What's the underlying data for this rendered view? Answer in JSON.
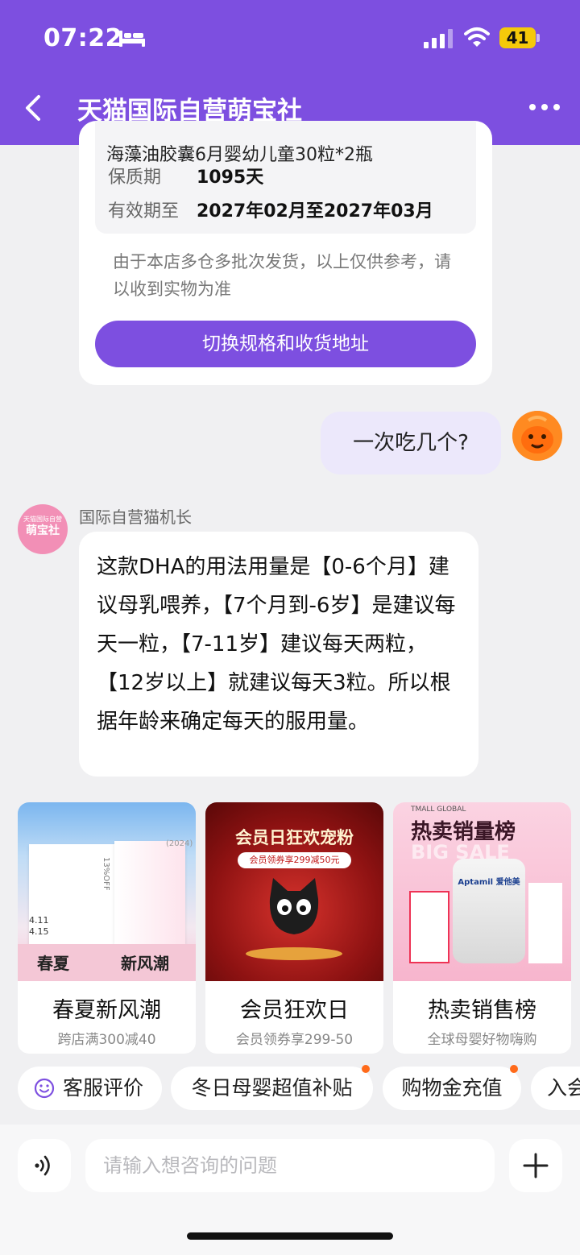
{
  "status_bar": {
    "time": "07:22",
    "battery": "41"
  },
  "nav": {
    "title": "天猫国际自营萌宝社"
  },
  "product_card": {
    "cut_line": "海藻油胶囊6月婴幼儿童30粒*2瓶",
    "rows": [
      {
        "label": "保质期",
        "value": "1095天"
      },
      {
        "label": "有效期至",
        "value": "2027年02月至2027年03月"
      }
    ],
    "note": "由于本店多仓多批次发货，以上仅供参考，请以收到实物为准",
    "switch_button": "切换规格和收货地址"
  },
  "user_message": {
    "text": "一次吃几个?"
  },
  "bot": {
    "avatar_line1": "天猫国际自营",
    "avatar_line2": "萌宝社",
    "name": "国际自营猫机长",
    "message": "这款DHA的用法用量是【0-6个月】建议母乳喂养，【7个月到-6岁】是建议每天一粒，【7-11岁】建议每天两粒，【12岁以上】就建议每天3粒。所以根据年龄来确定每天的服用量。"
  },
  "promos": [
    {
      "title": "春夏新风潮",
      "subtitle": "跨店满300减40",
      "image_caption": "春夏",
      "image_caption2": "新风潮",
      "image_tag": "(2024)",
      "image_date1": "4.11",
      "image_date2": "4.15",
      "image_off": "13%OFF"
    },
    {
      "title": "会员狂欢日",
      "subtitle": "会员领券享299-50",
      "image_caption": "会员日狂欢宠粉",
      "image_caption2": "会员领券享299减50元"
    },
    {
      "title": "热卖销售榜",
      "subtitle": "全球母婴好物嗨购",
      "image_caption": "热卖销量榜",
      "image_caption2": "TMALL GLOBAL",
      "image_brand": "Aptamil 爱他美",
      "image_big": "BIG SALE"
    }
  ],
  "chips": [
    {
      "label": "客服评价",
      "has_dot": false,
      "icon": "smile-icon"
    },
    {
      "label": "冬日母婴超值补贴",
      "has_dot": true
    },
    {
      "label": "购物金充值",
      "has_dot": true
    },
    {
      "label": "入会",
      "has_dot": false
    }
  ],
  "input": {
    "placeholder": "请输入想咨询的问题"
  },
  "colors": {
    "brand_purple": "#7d4fe0",
    "user_bubble": "#ece8fb",
    "dot_orange": "#ff6a1a"
  }
}
